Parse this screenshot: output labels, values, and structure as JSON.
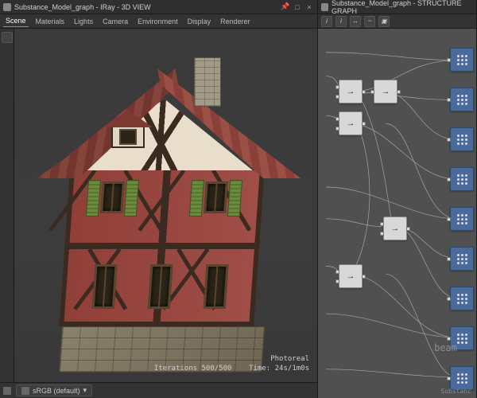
{
  "left_panel": {
    "title": "Substance_Model_graph - IRay - 3D VIEW",
    "tabs": [
      "Scene",
      "Materials",
      "Lights",
      "Camera",
      "Environment",
      "Display",
      "Renderer"
    ],
    "active_tab": 0,
    "status": {
      "line1": "Photoreal",
      "line2_label": "Iterations",
      "line2_value": "500/500",
      "line3_label": "Time",
      "line3_value": "24s/1m0s"
    },
    "bottom": {
      "colorspace": "sRGB (default)",
      "icon_name": "colorspace-icon"
    }
  },
  "right_panel": {
    "title": "Substance_Model_graph - STRUCTURE GRAPH",
    "toolbar_icons": [
      "cursor",
      "info",
      "expand",
      "link",
      "zoom"
    ],
    "label": "beam",
    "footer": "Substanc"
  },
  "node_types": {
    "grid": "grid-node",
    "merge": "merge-node"
  }
}
